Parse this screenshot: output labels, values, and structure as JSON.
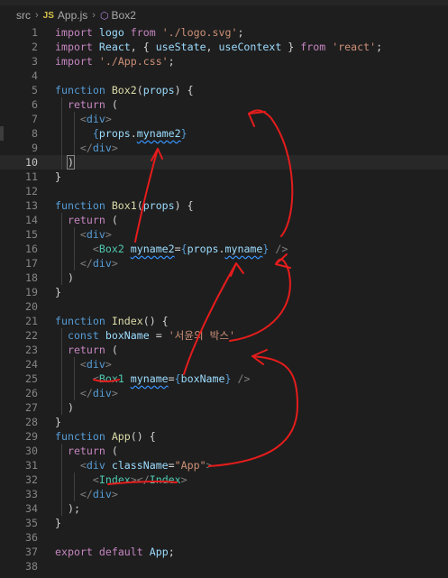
{
  "breadcrumb": {
    "folder": "src",
    "file": "App.js",
    "file_badge": "JS",
    "symbol": "Box2",
    "symbol_icon": "cube-icon"
  },
  "code_lines": [
    {
      "n": "1",
      "t": "import logo from './logo.svg';"
    },
    {
      "n": "2",
      "t": "import React, { useState, useContext } from 'react';"
    },
    {
      "n": "3",
      "t": "import './App.css';"
    },
    {
      "n": "4",
      "t": ""
    },
    {
      "n": "5",
      "t": "function Box2(props) {"
    },
    {
      "n": "6",
      "t": "  return ("
    },
    {
      "n": "7",
      "t": "    <div>"
    },
    {
      "n": "8",
      "t": "      {props.myname2}"
    },
    {
      "n": "9",
      "t": "    </div>"
    },
    {
      "n": "10",
      "t": "  )"
    },
    {
      "n": "11",
      "t": "}"
    },
    {
      "n": "12",
      "t": ""
    },
    {
      "n": "13",
      "t": "function Box1(props) {"
    },
    {
      "n": "14",
      "t": "  return ("
    },
    {
      "n": "15",
      "t": "    <div>"
    },
    {
      "n": "16",
      "t": "      <Box2 myname2={props.myname} />"
    },
    {
      "n": "17",
      "t": "    </div>"
    },
    {
      "n": "18",
      "t": "  )"
    },
    {
      "n": "19",
      "t": "}"
    },
    {
      "n": "20",
      "t": ""
    },
    {
      "n": "21",
      "t": "function Index() {"
    },
    {
      "n": "22",
      "t": "  const boxName = '서윤의 박스'"
    },
    {
      "n": "23",
      "t": "  return ("
    },
    {
      "n": "24",
      "t": "    <div>"
    },
    {
      "n": "25",
      "t": "      <Box1 myname={boxName} />"
    },
    {
      "n": "26",
      "t": "    </div>"
    },
    {
      "n": "27",
      "t": "  )"
    },
    {
      "n": "28",
      "t": "}"
    },
    {
      "n": "29",
      "t": "function App() {"
    },
    {
      "n": "30",
      "t": "  return ("
    },
    {
      "n": "31",
      "t": "    <div className=\"App\">"
    },
    {
      "n": "32",
      "t": "      <Index></Index>"
    },
    {
      "n": "33",
      "t": "    </div>"
    },
    {
      "n": "34",
      "t": "  );"
    },
    {
      "n": "35",
      "t": "}"
    },
    {
      "n": "36",
      "t": ""
    },
    {
      "n": "37",
      "t": "export default App;"
    },
    {
      "n": "38",
      "t": ""
    }
  ],
  "current_line": "10",
  "colors": {
    "background": "#1e1e1e",
    "annotation": "#e51c1c"
  }
}
